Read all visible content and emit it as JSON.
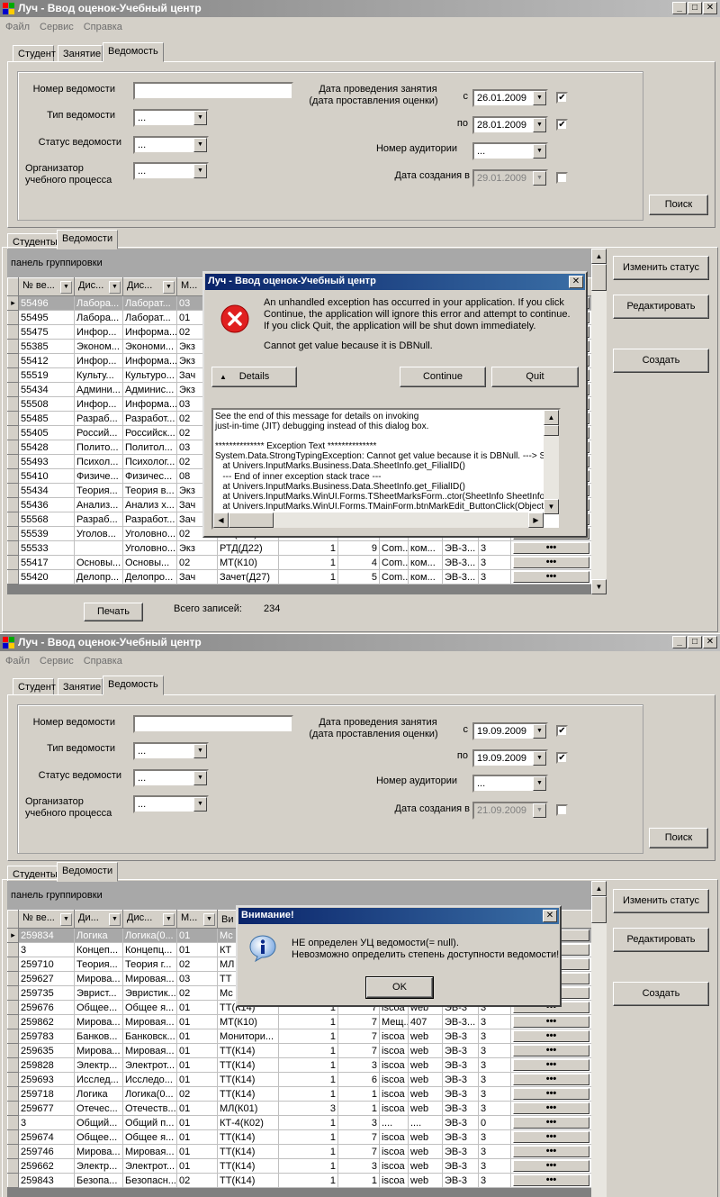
{
  "window1": {
    "title": "Луч - Ввод оценок-Учебный центр",
    "win_buttons": [
      "_",
      "□",
      "✕"
    ],
    "menu": [
      "Файл",
      "Сервис",
      "Справка"
    ],
    "top_tabs": [
      "Студент",
      "Занятие",
      "Ведомость"
    ],
    "filter": {
      "number_label": "Номер ведомости",
      "number_value": "",
      "type_label": "Тип ведомости",
      "type_value": "...",
      "status_label": "Статус ведомости",
      "status_value": "...",
      "org_label_1": "Организатор",
      "org_label_2": "учебного процесса",
      "org_value": "...",
      "date_label_1": "Дата проведения занятия",
      "date_label_2": "(дата проставления оценки)",
      "from_label": "с",
      "from_value": "26.01.2009",
      "from_checked": "✔",
      "to_label": "по",
      "to_value": "28.01.2009",
      "to_checked": "✔",
      "room_label": "Номер аудитории",
      "room_value": "...",
      "created_label": "Дата создания в",
      "created_value": "29.01.2009",
      "created_checked": "",
      "search_button": "Поиск"
    },
    "bottom_tabs": [
      "Студенты",
      "Ведомости"
    ],
    "group_panel": "панель группировки",
    "headers": [
      "№ ве...",
      "Дис...",
      "Дис...",
      "М..."
    ],
    "rows": [
      [
        "55496",
        "Лабора...",
        "Лаборат...",
        "03",
        "МТ(К10)",
        "",
        "",
        "",
        "",
        "",
        ""
      ],
      [
        "55495",
        "Лабора...",
        "Лаборат...",
        "01",
        "",
        "",
        "",
        "",
        "",
        "",
        ""
      ],
      [
        "55475",
        "Инфор...",
        "Информа...",
        "02",
        "",
        "",
        "",
        "",
        "",
        "",
        ""
      ],
      [
        "55385",
        "Эконом...",
        "Экономи...",
        "Экз",
        "",
        "",
        "",
        "",
        "",
        "",
        ""
      ],
      [
        "55412",
        "Инфор...",
        "Информа...",
        "Экз",
        "",
        "",
        "",
        "",
        "",
        "",
        ""
      ],
      [
        "55519",
        "Культу...",
        "Культуро...",
        "Зач",
        "",
        "",
        "",
        "",
        "",
        "",
        ""
      ],
      [
        "55434",
        "Админи...",
        "Админис...",
        "Экз",
        "",
        "",
        "",
        "",
        "",
        "",
        ""
      ],
      [
        "55508",
        "Инфор...",
        "Информа...",
        "03",
        "",
        "",
        "",
        "",
        "",
        "",
        ""
      ],
      [
        "55485",
        "Разраб...",
        "Разработ...",
        "02",
        "",
        "",
        "",
        "",
        "",
        "",
        ""
      ],
      [
        "55405",
        "Россий...",
        "Российск...",
        "02",
        "",
        "",
        "",
        "",
        "",
        "",
        ""
      ],
      [
        "55428",
        "Полито...",
        "Политол...",
        "03",
        "",
        "",
        "",
        "",
        "",
        "",
        ""
      ],
      [
        "55493",
        "Психол...",
        "Психолог...",
        "02",
        "",
        "",
        "",
        "",
        "",
        "",
        ""
      ],
      [
        "55410",
        "Физиче...",
        "Физичес...",
        "08",
        "",
        "",
        "",
        "",
        "",
        "",
        ""
      ],
      [
        "55434",
        "Теория...",
        "Теория в...",
        "Экз",
        "",
        "",
        "",
        "",
        "",
        "",
        ""
      ],
      [
        "55436",
        "Анализ...",
        "Анализ х...",
        "Зач",
        "",
        "",
        "",
        "",
        "",
        "",
        ""
      ],
      [
        "55568",
        "Разраб...",
        "Разработ...",
        "Зач",
        "",
        "",
        "",
        "",
        "",
        "",
        ""
      ],
      [
        "55539",
        "Уголов...",
        "Уголовно...",
        "02",
        "МТ(К10)",
        "1",
        "3",
        "Com...",
        "ком...",
        "ЭВ-3...",
        "3"
      ],
      [
        "55533",
        "",
        "Уголовно...",
        "Экз",
        "РТД(Д22)",
        "1",
        "9",
        "Com...",
        "ком...",
        "ЭВ-3...",
        "3"
      ],
      [
        "55417",
        "Основы...",
        "Основы...",
        "02",
        "МТ(К10)",
        "1",
        "4",
        "Com...",
        "ком...",
        "ЭВ-3...",
        "3"
      ],
      [
        "55420",
        "Делопр...",
        "Делопро...",
        "Зач",
        "Зачет(Д27)",
        "1",
        "5",
        "Com...",
        "ком...",
        "ЭВ-3...",
        "3"
      ]
    ],
    "print_button": "Печать",
    "total_label": "Всего записей:",
    "total_value": "234",
    "side_buttons": [
      "Изменить статус",
      "Редактировать",
      "Создать"
    ],
    "dots": "•••",
    "dialog": {
      "title": "Луч - Ввод оценок-Учебный центр",
      "close": "✕",
      "message": [
        "An unhandled exception has occurred in your application. If you click",
        "Continue, the application will ignore this error and attempt to continue.",
        "If you click Quit, the application will be shut down immediately."
      ],
      "message2": "Cannot get value because it is DBNull.",
      "details_button": "Details",
      "continue_button": "Continue",
      "quit_button": "Quit",
      "details_text": [
        "See the end of this message for details on invoking",
        "just-in-time (JIT) debugging instead of this dialog box.",
        "",
        "************** Exception Text **************",
        "System.Data.StrongTypingException: Cannot get value because it is DBNull. ---> Sys",
        "   at Univers.InputMarks.Business.Data.SheetInfo.get_FilialID()",
        "   --- End of inner exception stack trace ---",
        "   at Univers.InputMarks.Business.Data.SheetInfo.get_FilialID()",
        "   at Univers.InputMarks.WinUI.Forms.TSheetMarksForm..ctor(SheetInfo SheetInforc",
        "   at Univers.InputMarks.WinUI.Forms.TMainForm.btnMarkEdit_ButtonClick(Object s"
      ]
    }
  },
  "window2": {
    "title": "Луч - Ввод оценок-Учебный центр",
    "win_buttons": [
      "_",
      "□",
      "✕"
    ],
    "menu": [
      "Файл",
      "Сервис",
      "Справка"
    ],
    "top_tabs": [
      "Студент",
      "Занятие",
      "Ведомость"
    ],
    "filter": {
      "number_label": "Номер ведомости",
      "number_value": "",
      "type_label": "Тип ведомости",
      "type_value": "...",
      "status_label": "Статус ведомости",
      "status_value": "...",
      "org_label_1": "Организатор",
      "org_label_2": "учебного процесса",
      "org_value": "...",
      "date_label_1": "Дата проведения занятия",
      "date_label_2": "(дата проставления оценки)",
      "from_label": "с",
      "from_value": "19.09.2009",
      "from_checked": "✔",
      "to_label": "по",
      "to_value": "19.09.2009",
      "to_checked": "✔",
      "room_label": "Номер аудитории",
      "room_value": "...",
      "created_label": "Дата создания в",
      "created_value": "21.09.2009",
      "created_checked": "",
      "search_button": "Поиск"
    },
    "bottom_tabs": [
      "Студенты",
      "Ведомости"
    ],
    "group_panel": "панель группировки",
    "headers": [
      "№ ве...",
      "Ди...",
      "Дис...",
      "М...",
      "Ви"
    ],
    "rows": [
      [
        "259834",
        "Логика",
        "Логика(0...",
        "01",
        "Мс",
        "",
        "",
        "",
        "",
        "",
        ""
      ],
      [
        "3",
        "Концеп...",
        "Концепц...",
        "01",
        "КТ",
        "",
        "",
        "",
        "",
        "",
        ""
      ],
      [
        "259710",
        "Теория...",
        "Теория г...",
        "02",
        "МЛ",
        "",
        "",
        "",
        "",
        "",
        ""
      ],
      [
        "259627",
        "Мирова...",
        "Мировая...",
        "03",
        "ТТ",
        "",
        "",
        "",
        "",
        "",
        ""
      ],
      [
        "259735",
        "Эврист...",
        "Эвристик...",
        "02",
        "Мс",
        "",
        "",
        "",
        "",
        "",
        ""
      ],
      [
        "259676",
        "Общее...",
        "Общее я...",
        "01",
        "ТТ(К14)",
        "1",
        "7",
        "iscoa",
        "web",
        "ЭВ-3",
        "3"
      ],
      [
        "259862",
        "Мирова...",
        "Мировая...",
        "01",
        "МТ(К10)",
        "1",
        "7",
        "Мещ...",
        "407",
        "ЭВ-3...",
        "3"
      ],
      [
        "259783",
        "Банков...",
        "Банковск...",
        "01",
        "Монитори...",
        "1",
        "7",
        "iscoa",
        "web",
        "ЭВ-3",
        "3"
      ],
      [
        "259635",
        "Мирова...",
        "Мировая...",
        "01",
        "ТТ(К14)",
        "1",
        "7",
        "iscoa",
        "web",
        "ЭВ-3",
        "3"
      ],
      [
        "259828",
        "Электр...",
        "Электрот...",
        "01",
        "ТТ(К14)",
        "1",
        "3",
        "iscoa",
        "web",
        "ЭВ-3",
        "3"
      ],
      [
        "259693",
        "Исслед...",
        "Исследо...",
        "01",
        "ТТ(К14)",
        "1",
        "6",
        "iscoa",
        "web",
        "ЭВ-3",
        "3"
      ],
      [
        "259718",
        "Логика",
        "Логика(0...",
        "02",
        "ТТ(К14)",
        "1",
        "1",
        "iscoa",
        "web",
        "ЭВ-3",
        "3"
      ],
      [
        "259677",
        "Отечес...",
        "Отечеств...",
        "01",
        "МЛ(К01)",
        "3",
        "1",
        "iscoa",
        "web",
        "ЭВ-3",
        "3"
      ],
      [
        "3",
        "Общий...",
        "Общий п...",
        "01",
        "КТ-4(К02)",
        "1",
        "3",
        "....",
        "....",
        "ЭВ-3",
        "0"
      ],
      [
        "259674",
        "Общее...",
        "Общее я...",
        "01",
        "ТТ(К14)",
        "1",
        "7",
        "iscoa",
        "web",
        "ЭВ-3",
        "3"
      ],
      [
        "259746",
        "Мирова...",
        "Мировая...",
        "01",
        "ТТ(К14)",
        "1",
        "7",
        "iscoa",
        "web",
        "ЭВ-3",
        "3"
      ],
      [
        "259662",
        "Электр...",
        "Электрот...",
        "01",
        "ТТ(К14)",
        "1",
        "3",
        "iscoa",
        "web",
        "ЭВ-3",
        "3"
      ],
      [
        "259843",
        "Безопа...",
        "Безопасн...",
        "02",
        "ТТ(К14)",
        "1",
        "1",
        "iscoa",
        "web",
        "ЭВ-3",
        "3"
      ]
    ],
    "side_buttons": [
      "Изменить статус",
      "Редактировать",
      "Создать"
    ],
    "dots": "•••",
    "dialog": {
      "title": "Внимание!",
      "close": "✕",
      "message": [
        "НЕ определен УЦ ведомости(= null).",
        "Невозможно определить степень доступности ведомости!"
      ],
      "ok_button": "OK"
    }
  }
}
